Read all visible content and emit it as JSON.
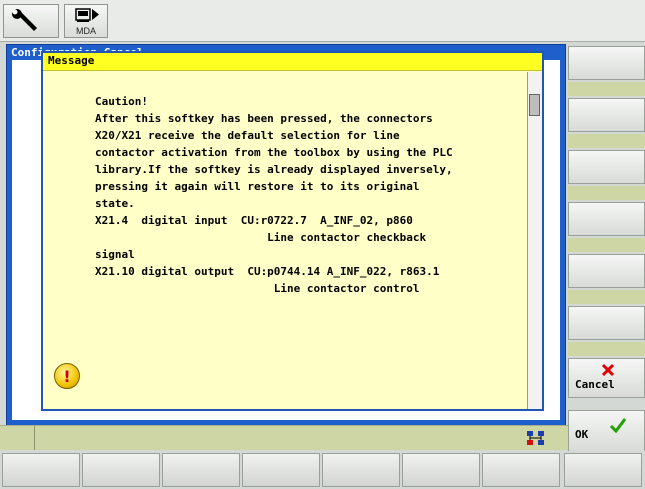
{
  "topbar": {
    "buttons": [
      {
        "name": "wrench-button",
        "icon": "wrench-icon"
      },
      {
        "name": "mda-button",
        "icon": "monitor-arrow-icon",
        "label": "MDA"
      }
    ]
  },
  "background_window": {
    "title": "Configuration   Cancel"
  },
  "dialog": {
    "title": "Message",
    "text": "Caution!\nAfter this softkey has been pressed, the connectors\nX20/X21 receive the default selection for line\ncontactor activation from the toolbox by using the PLC\nlibrary.If the softkey is already displayed inversely,\npressing it again will restore it to its original\nstate.\nX21.4  digital input  CU:r0722.7  A_INF_02, p860\n                          Line contactor checkback\nsignal\nX21.10 digital output  CU:p0744.14 A_INF_022, r863.1\n                           Line contactor control",
    "icon": "warning-exclamation-icon"
  },
  "softkeys": {
    "cancel": {
      "label": "Cancel",
      "icon": "red-x-icon",
      "color": "#e00000"
    },
    "ok": {
      "label": "OK",
      "icon": "green-check-icon",
      "color": "#22a000"
    }
  },
  "status": {
    "icon": "network-icon"
  },
  "colors": {
    "dialog_title": "#ffff22",
    "dialog_body": "#ffffc8",
    "window_frame": "#1f5fcc",
    "status_bar": "#cfd6a6"
  }
}
